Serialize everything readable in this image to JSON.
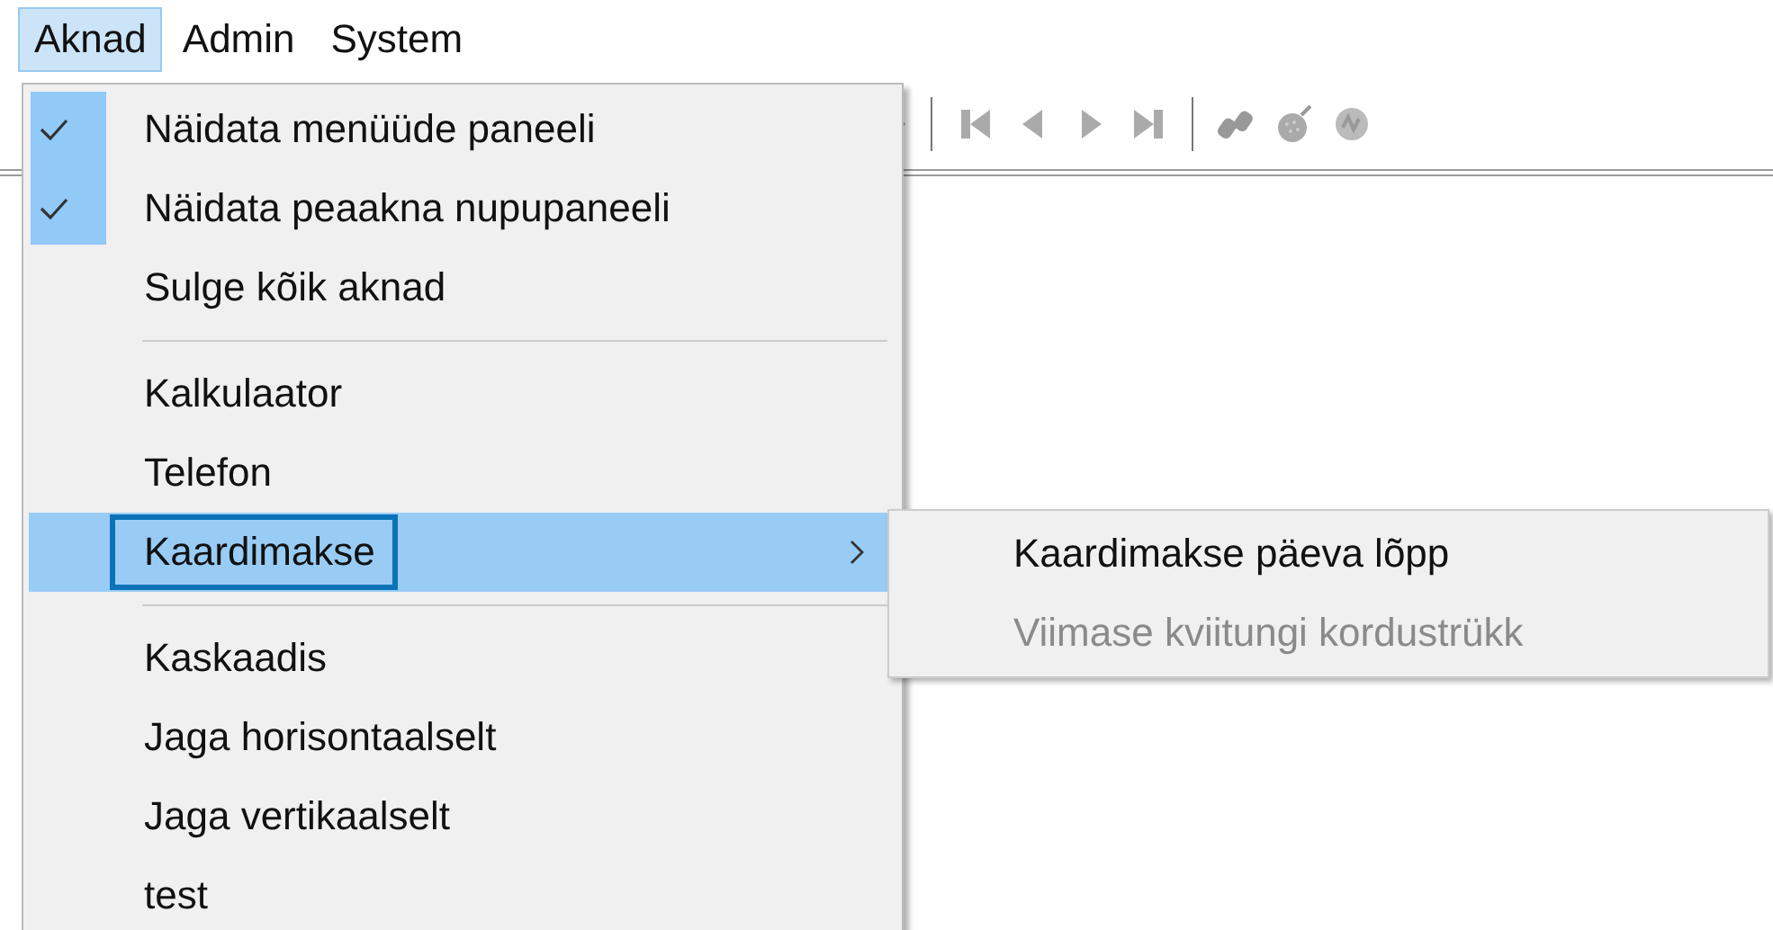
{
  "menu_bar": [
    {
      "label": "Aknad",
      "selected": true
    },
    {
      "label": "Admin",
      "selected": false
    },
    {
      "label": "System",
      "selected": false
    }
  ],
  "dropdown": {
    "items": [
      {
        "kind": "item",
        "label": "Näidata menüüde paneeli",
        "checked": true,
        "selected": false,
        "has_submenu": false
      },
      {
        "kind": "item",
        "label": "Näidata peaakna nupupaneeli",
        "checked": true,
        "selected": false,
        "has_submenu": false
      },
      {
        "kind": "item",
        "label": "Sulge kõik aknad",
        "checked": false,
        "selected": false,
        "has_submenu": false
      },
      {
        "kind": "separator"
      },
      {
        "kind": "item",
        "label": "Kalkulaator",
        "checked": false,
        "selected": false,
        "has_submenu": false
      },
      {
        "kind": "item",
        "label": "Telefon",
        "checked": false,
        "selected": false,
        "has_submenu": false
      },
      {
        "kind": "item",
        "label": "Kaardimakse",
        "checked": false,
        "selected": true,
        "has_submenu": true
      },
      {
        "kind": "separator"
      },
      {
        "kind": "item",
        "label": "Kaskaadis",
        "checked": false,
        "selected": false,
        "has_submenu": false
      },
      {
        "kind": "item",
        "label": "Jaga horisontaalselt",
        "checked": false,
        "selected": false,
        "has_submenu": false
      },
      {
        "kind": "item",
        "label": "Jaga vertikaalselt",
        "checked": false,
        "selected": false,
        "has_submenu": false
      },
      {
        "kind": "item",
        "label": "test",
        "checked": false,
        "selected": false,
        "has_submenu": false
      }
    ]
  },
  "submenu": {
    "items": [
      {
        "label": "Kaardimakse päeva lõpp",
        "disabled": false
      },
      {
        "label": "Viimase kviitungi kordustrükk",
        "disabled": true
      }
    ]
  }
}
